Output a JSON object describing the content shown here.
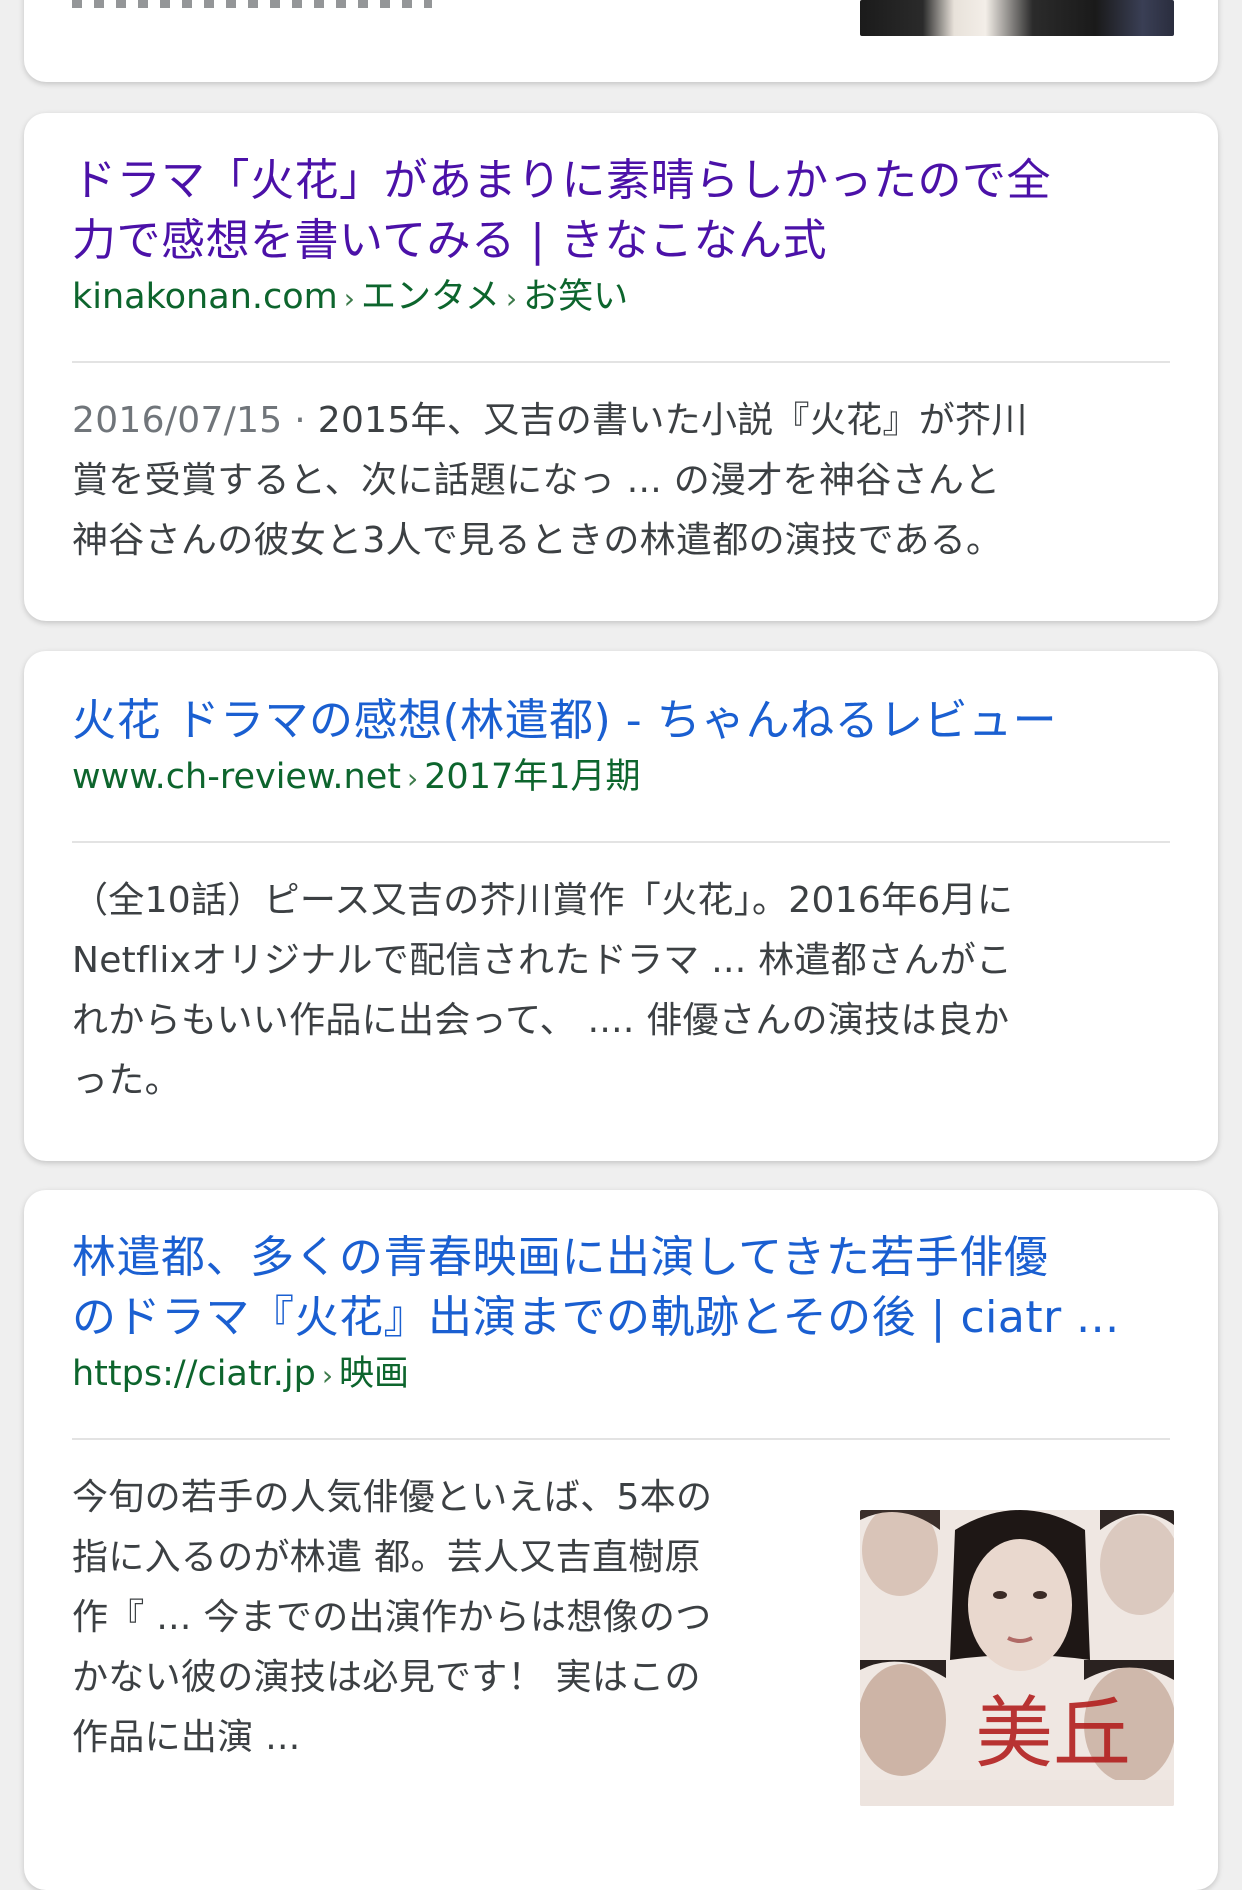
{
  "results": [
    {
      "title": "ドラマ「火花」があまりに素晴らしかったので全力で感想を書いてみる | きなこなん式",
      "title_line1": "ドラマ「火花」があまりに素晴らしかったので全",
      "title_line2": "力で感想を書いてみる | きなこなん式",
      "url_domain": "kinakonan.com",
      "url_path1": "エンタメ",
      "url_path2": "お笑い",
      "date": "2016/07/15",
      "snippet_line1": "2015年、又吉の書いた小説『火花』が芥川",
      "snippet_line2": "賞を受賞すると、次に話題になっ ... の漫才を神谷さんと",
      "snippet_line3": "神谷さんの彼女と3人で見るときの林遣都の演技である。"
    },
    {
      "title": "火花 ドラマの感想(林遣都) - ちゃんねるレビュー",
      "url_domain": "www.ch-review.net",
      "url_path1": "2017年1月期",
      "snippet_line1": "（全10話）ピース又吉の芥川賞作「火花」。2016年6月に",
      "snippet_line2": "Netflixオリジナルで配信されたドラマ ... 林遣都さんがこ",
      "snippet_line3": "れからもいい作品に出会って、 .... 俳優さんの演技は良か",
      "snippet_line4": "った。"
    },
    {
      "title_line1": "林遣都、多くの青春映画に出演してきた若手俳優",
      "title_line2": "のドラマ『火花』出演までの軌跡とその後 | ciatr ...",
      "url_domain": "https://ciatr.jp",
      "url_path1": "映画",
      "snippet_line1": "今旬の若手の人気俳優といえば、5本の",
      "snippet_line2": "指に入るのが林遣 都。芸人又吉直樹原",
      "snippet_line3": "作『 ... 今までの出演作からは想像のつ",
      "snippet_line4": "かない彼の演技は必見です！ 実はこの",
      "snippet_line5": "作品に出演 ...",
      "thumbnail_text": "美丘"
    }
  ],
  "colors": {
    "visited_link": "#4b11a8",
    "link": "#1a5fd1",
    "url_green": "#0d652d",
    "snippet": "#3c4043",
    "date_gray": "#70757a",
    "page_bg": "#efefef"
  }
}
